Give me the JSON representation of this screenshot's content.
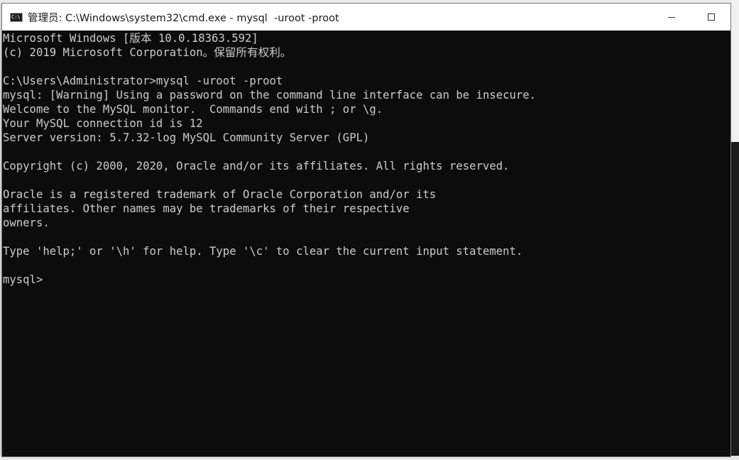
{
  "window": {
    "title": "管理员: C:\\Windows\\system32\\cmd.exe - mysql  -uroot -proot",
    "app_icon_text": "C:\\"
  },
  "console": {
    "lines": [
      "Microsoft Windows [版本 10.0.18363.592]",
      "(c) 2019 Microsoft Corporation。保留所有权利。",
      "",
      "C:\\Users\\Administrator>mysql -uroot -proot",
      "mysql: [Warning] Using a password on the command line interface can be insecure.",
      "Welcome to the MySQL monitor.  Commands end with ; or \\g.",
      "Your MySQL connection id is 12",
      "Server version: 5.7.32-log MySQL Community Server (GPL)",
      "",
      "Copyright (c) 2000, 2020, Oracle and/or its affiliates. All rights reserved.",
      "",
      "Oracle is a registered trademark of Oracle Corporation and/or its",
      "affiliates. Other names may be trademarks of their respective",
      "owners.",
      "",
      "Type 'help;' or '\\h' for help. Type '\\c' to clear the current input statement.",
      "",
      "mysql>"
    ]
  },
  "colors": {
    "console_bg": "#0c0c0c",
    "console_fg": "#cccccc",
    "titlebar_bg": "#ffffff"
  },
  "icons": {
    "app": "console-app-icon",
    "minimize": "minimize-icon",
    "maximize": "maximize-icon"
  }
}
